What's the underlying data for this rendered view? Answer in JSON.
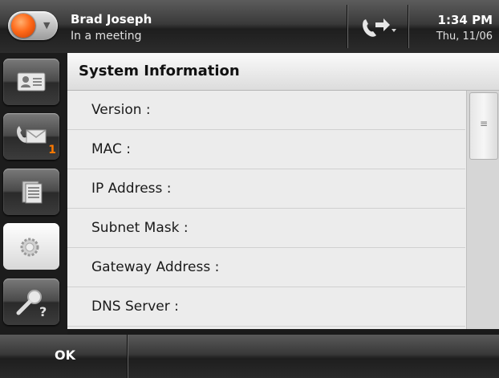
{
  "status_bar": {
    "user_name": "Brad Joseph",
    "user_status": "In a meeting",
    "time": "1:34 PM",
    "date": "Thu, 11/06",
    "presence_color": "#ff6a1a"
  },
  "side_rail": {
    "items": [
      {
        "name": "contacts",
        "icon": "contact-card-icon",
        "active": false,
        "badge": ""
      },
      {
        "name": "messages",
        "icon": "voicemail-envelope-icon",
        "active": false,
        "badge": "1"
      },
      {
        "name": "call-log",
        "icon": "call-log-list-icon",
        "active": false,
        "badge": ""
      },
      {
        "name": "settings",
        "icon": "gear-icon",
        "active": true,
        "badge": ""
      },
      {
        "name": "search",
        "icon": "search-magnifier-icon",
        "active": false,
        "badge": ""
      }
    ]
  },
  "panel": {
    "title": "System Information",
    "rows": [
      {
        "label": "Version :"
      },
      {
        "label": "MAC :"
      },
      {
        "label": "IP Address :"
      },
      {
        "label": "Subnet Mask :"
      },
      {
        "label": "Gateway Address :"
      },
      {
        "label": "DNS Server :"
      }
    ]
  },
  "softkeys": {
    "ok_label": "OK"
  }
}
